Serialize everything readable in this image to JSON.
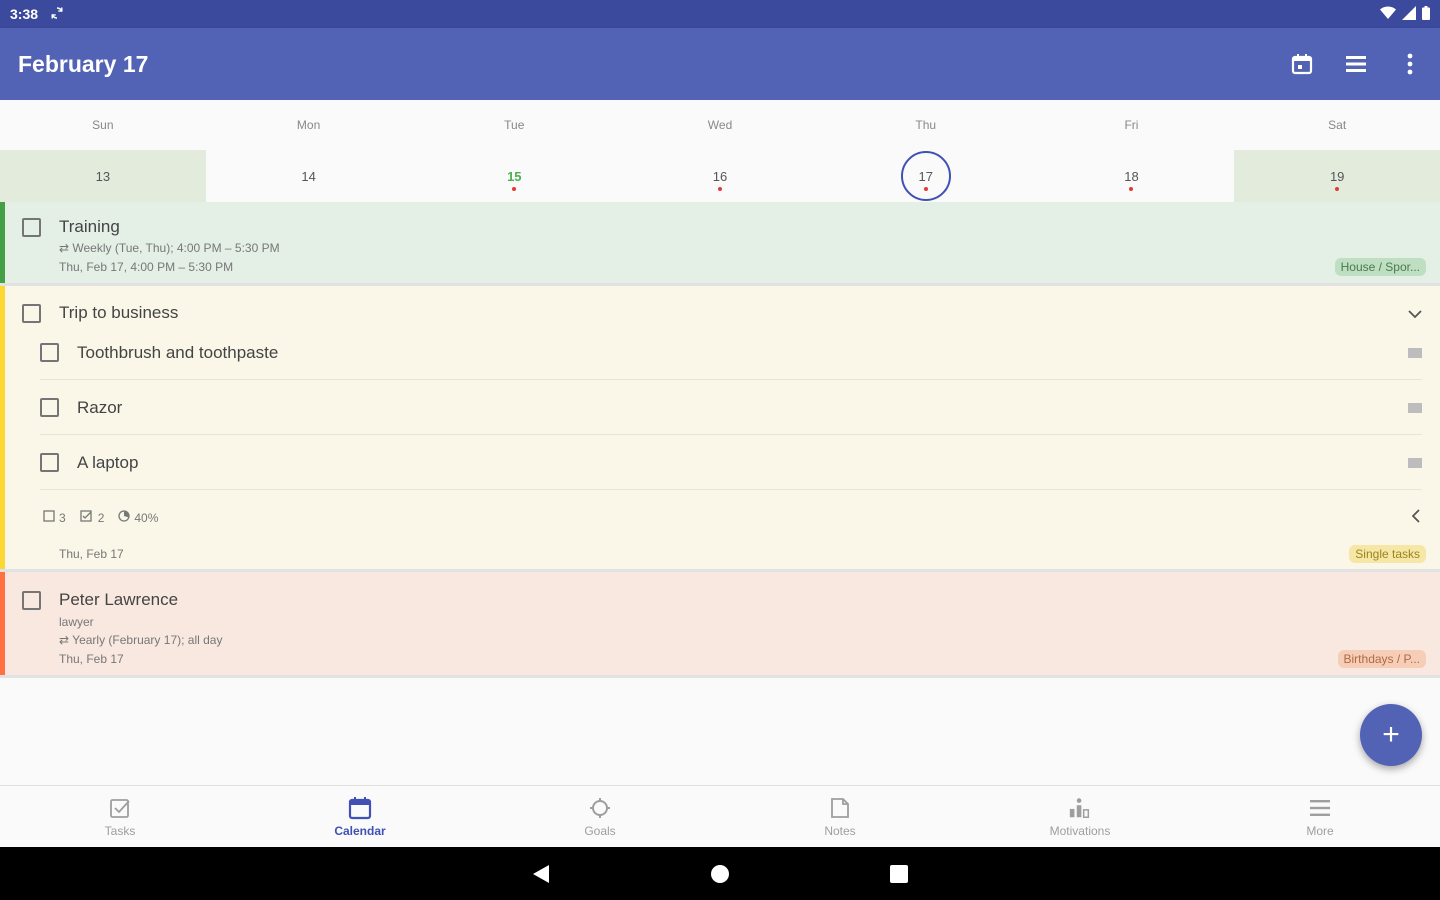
{
  "status_bar": {
    "time": "3:38",
    "icons": [
      "sync-icon",
      "wifi-icon",
      "signal-icon",
      "battery-icon"
    ]
  },
  "app_bar": {
    "title": "February 17",
    "actions": [
      "calendar-today-icon",
      "view-list-icon",
      "more-vert-icon"
    ]
  },
  "week": {
    "day_names": [
      "Sun",
      "Mon",
      "Tue",
      "Wed",
      "Thu",
      "Fri",
      "Sat"
    ],
    "dates": [
      {
        "day": "13",
        "weekend": true,
        "dot": false
      },
      {
        "day": "14",
        "weekend": false,
        "dot": false
      },
      {
        "day": "15",
        "weekend": false,
        "dot": true,
        "green": true
      },
      {
        "day": "16",
        "weekend": false,
        "dot": true
      },
      {
        "day": "17",
        "weekend": false,
        "dot": true,
        "today": true
      },
      {
        "day": "18",
        "weekend": false,
        "dot": true
      },
      {
        "day": "19",
        "weekend": true,
        "dot": true
      }
    ]
  },
  "tasks": {
    "training": {
      "title": "Training",
      "repeat": "Weekly (Tue, Thu); 4:00 PM – 5:30 PM",
      "when": "Thu, Feb 17, 4:00 PM – 5:30 PM",
      "tag": "House / Spor...",
      "color": "#43a047"
    },
    "trip": {
      "title": "Trip to business",
      "subtasks": [
        "Toothbrush and toothpaste",
        "Razor",
        "A laptop"
      ],
      "stats": {
        "total": "3",
        "done": "2",
        "progress": "40%"
      },
      "when": "Thu, Feb 17",
      "tag": "Single tasks",
      "color": "#fdd835"
    },
    "peter": {
      "title": "Peter Lawrence",
      "note": "lawyer",
      "repeat": "Yearly (February 17); all day",
      "when": "Thu, Feb 17",
      "tag": "Birthdays / P...",
      "color": "#ff7043"
    }
  },
  "fab": {
    "label": "+"
  },
  "bottom_nav": [
    {
      "label": "Tasks",
      "icon": "task-check-icon",
      "active": false
    },
    {
      "label": "Calendar",
      "icon": "calendar-icon",
      "active": true
    },
    {
      "label": "Goals",
      "icon": "goal-target-icon",
      "active": false
    },
    {
      "label": "Notes",
      "icon": "note-icon",
      "active": false
    },
    {
      "label": "Motivations",
      "icon": "motivation-icon",
      "active": false
    },
    {
      "label": "More",
      "icon": "menu-icon",
      "active": false
    }
  ],
  "accent_color": "#5262b5"
}
